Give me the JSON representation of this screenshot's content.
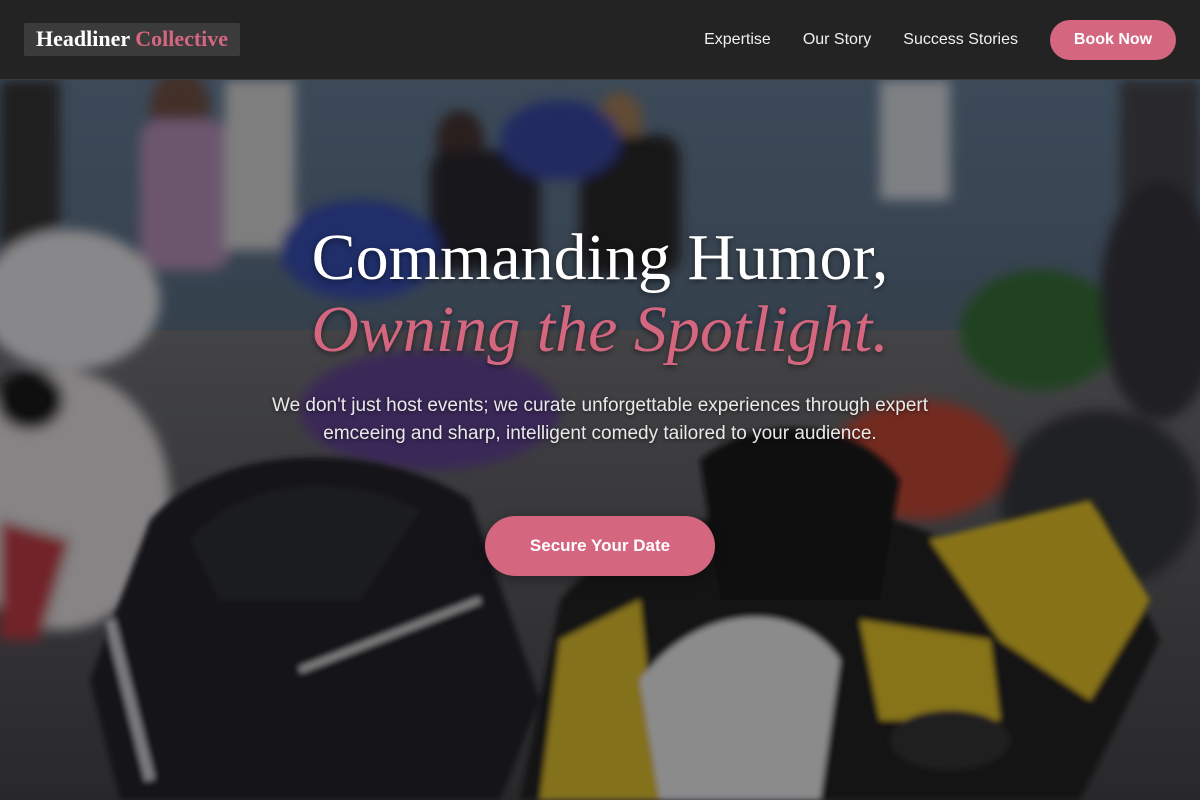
{
  "header": {
    "logo_main": "Headliner",
    "logo_accent": "Collective",
    "nav": [
      "Expertise",
      "Our Story",
      "Success Stories"
    ],
    "book_label": "Book Now"
  },
  "hero": {
    "title_line1": "Commanding Humor,",
    "title_line2": "Owning the Spotlight.",
    "subtitle": "We don't just host events; we curate unforgettable experiences through expert emceeing and sharp, intelligent comedy tailored to your audience.",
    "cta_label": "Secure Your Date",
    "background": "motorcycle-crowd-photo"
  },
  "colors": {
    "accent": "#d4677f",
    "header_bg": "#232323"
  }
}
